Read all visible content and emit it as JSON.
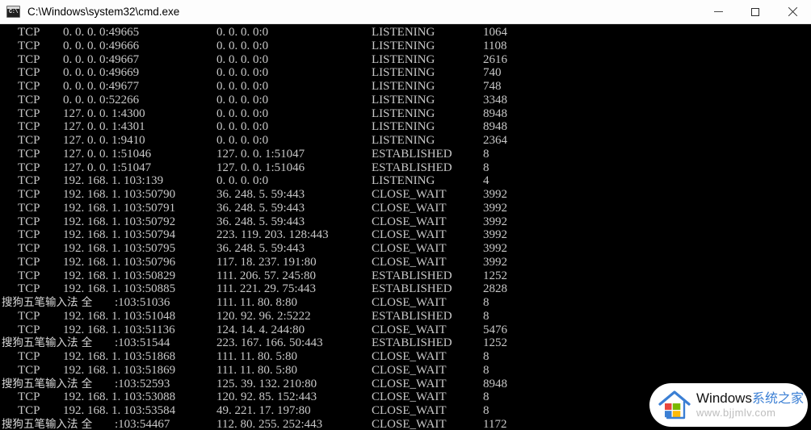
{
  "window": {
    "title": "C:\\Windows\\system32\\cmd.exe",
    "icon_name": "cmd-icon",
    "icon_text": "C:\\",
    "controls": {
      "minimize_label": "Minimize",
      "maximize_label": "Maximize",
      "close_label": "Close"
    }
  },
  "console": {
    "background_color": "#000000",
    "text_color": "#c8c8c8",
    "ime_overlay_text": "搜狗五笔输入法 全",
    "rows": [
      {
        "proto": "TCP",
        "local": "0. 0. 0. 0:49665",
        "foreign": "0. 0. 0. 0:0",
        "state": "LISTENING",
        "pid": "1064",
        "ime": false
      },
      {
        "proto": "TCP",
        "local": "0. 0. 0. 0:49666",
        "foreign": "0. 0. 0. 0:0",
        "state": "LISTENING",
        "pid": "1108",
        "ime": false
      },
      {
        "proto": "TCP",
        "local": "0. 0. 0. 0:49667",
        "foreign": "0. 0. 0. 0:0",
        "state": "LISTENING",
        "pid": "2616",
        "ime": false
      },
      {
        "proto": "TCP",
        "local": "0. 0. 0. 0:49669",
        "foreign": "0. 0. 0. 0:0",
        "state": "LISTENING",
        "pid": "740",
        "ime": false
      },
      {
        "proto": "TCP",
        "local": "0. 0. 0. 0:49677",
        "foreign": "0. 0. 0. 0:0",
        "state": "LISTENING",
        "pid": "748",
        "ime": false
      },
      {
        "proto": "TCP",
        "local": "0. 0. 0. 0:52266",
        "foreign": "0. 0. 0. 0:0",
        "state": "LISTENING",
        "pid": "3348",
        "ime": false
      },
      {
        "proto": "TCP",
        "local": "127. 0. 0. 1:4300",
        "foreign": "0. 0. 0. 0:0",
        "state": "LISTENING",
        "pid": "8948",
        "ime": false
      },
      {
        "proto": "TCP",
        "local": "127. 0. 0. 1:4301",
        "foreign": "0. 0. 0. 0:0",
        "state": "LISTENING",
        "pid": "8948",
        "ime": false
      },
      {
        "proto": "TCP",
        "local": "127. 0. 0. 1:9410",
        "foreign": "0. 0. 0. 0:0",
        "state": "LISTENING",
        "pid": "2364",
        "ime": false
      },
      {
        "proto": "TCP",
        "local": "127. 0. 0. 1:51046",
        "foreign": "127. 0. 0. 1:51047",
        "state": "ESTABLISHED",
        "pid": "8",
        "ime": false
      },
      {
        "proto": "TCP",
        "local": "127. 0. 0. 1:51047",
        "foreign": "127. 0. 0. 1:51046",
        "state": "ESTABLISHED",
        "pid": "8",
        "ime": false
      },
      {
        "proto": "TCP",
        "local": "192. 168. 1. 103:139",
        "foreign": "0. 0. 0. 0:0",
        "state": "LISTENING",
        "pid": "4",
        "ime": false
      },
      {
        "proto": "TCP",
        "local": "192. 168. 1. 103:50790",
        "foreign": "36. 248. 5. 59:443",
        "state": "CLOSE_WAIT",
        "pid": "3992",
        "ime": false
      },
      {
        "proto": "TCP",
        "local": "192. 168. 1. 103:50791",
        "foreign": "36. 248. 5. 59:443",
        "state": "CLOSE_WAIT",
        "pid": "3992",
        "ime": false
      },
      {
        "proto": "TCP",
        "local": "192. 168. 1. 103:50792",
        "foreign": "36. 248. 5. 59:443",
        "state": "CLOSE_WAIT",
        "pid": "3992",
        "ime": false
      },
      {
        "proto": "TCP",
        "local": "192. 168. 1. 103:50794",
        "foreign": "223. 119. 203. 128:443",
        "state": "CLOSE_WAIT",
        "pid": "3992",
        "ime": false
      },
      {
        "proto": "TCP",
        "local": "192. 168. 1. 103:50795",
        "foreign": "36. 248. 5. 59:443",
        "state": "CLOSE_WAIT",
        "pid": "3992",
        "ime": false
      },
      {
        "proto": "TCP",
        "local": "192. 168. 1. 103:50796",
        "foreign": "117. 18. 237. 191:80",
        "state": "CLOSE_WAIT",
        "pid": "3992",
        "ime": false
      },
      {
        "proto": "TCP",
        "local": "192. 168. 1. 103:50829",
        "foreign": "111. 206. 57. 245:80",
        "state": "ESTABLISHED",
        "pid": "1252",
        "ime": false
      },
      {
        "proto": "TCP",
        "local": "192. 168. 1. 103:50885",
        "foreign": "111. 221. 29. 75:443",
        "state": "ESTABLISHED",
        "pid": "2828",
        "ime": false
      },
      {
        "proto": "TCP",
        "local": ":103:51036",
        "foreign": "111. 11. 80. 8:80",
        "state": "CLOSE_WAIT",
        "pid": "8",
        "ime": true
      },
      {
        "proto": "TCP",
        "local": "192. 168. 1. 103:51048",
        "foreign": "120. 92. 96. 2:5222",
        "state": "ESTABLISHED",
        "pid": "8",
        "ime": false
      },
      {
        "proto": "TCP",
        "local": "192. 168. 1. 103:51136",
        "foreign": "124. 14. 4. 244:80",
        "state": "CLOSE_WAIT",
        "pid": "5476",
        "ime": false
      },
      {
        "proto": "TCP",
        "local": ":103:51544",
        "foreign": "223. 167. 166. 50:443",
        "state": "ESTABLISHED",
        "pid": "1252",
        "ime": true
      },
      {
        "proto": "TCP",
        "local": "192. 168. 1. 103:51868",
        "foreign": "111. 11. 80. 5:80",
        "state": "CLOSE_WAIT",
        "pid": "8",
        "ime": false
      },
      {
        "proto": "TCP",
        "local": "192. 168. 1. 103:51869",
        "foreign": "111. 11. 80. 5:80",
        "state": "CLOSE_WAIT",
        "pid": "8",
        "ime": false
      },
      {
        "proto": "TCP",
        "local": ":103:52593",
        "foreign": "125. 39. 132. 210:80",
        "state": "CLOSE_WAIT",
        "pid": "8948",
        "ime": true
      },
      {
        "proto": "TCP",
        "local": "192. 168. 1. 103:53088",
        "foreign": "120. 92. 85. 152:443",
        "state": "CLOSE_WAIT",
        "pid": "8",
        "ime": false
      },
      {
        "proto": "TCP",
        "local": "192. 168. 1. 103:53584",
        "foreign": "49. 221. 17. 197:80",
        "state": "CLOSE_WAIT",
        "pid": "8",
        "ime": false
      },
      {
        "proto": "TCP",
        "local": ":103:54467",
        "foreign": "112. 80. 255. 252:443",
        "state": "CLOSE_WAIT",
        "pid": "1172",
        "ime": true
      }
    ]
  },
  "watermark": {
    "brand": "Windows",
    "brand_cn": "系统之家",
    "url": "www.bjjmlv.com",
    "logo_name": "windows-house-logo",
    "accent_color": "#3b7fd4",
    "flag_colors": {
      "red": "#e8453c",
      "green": "#7ab800",
      "blue": "#3b7fd4",
      "yellow": "#ffba08"
    }
  }
}
